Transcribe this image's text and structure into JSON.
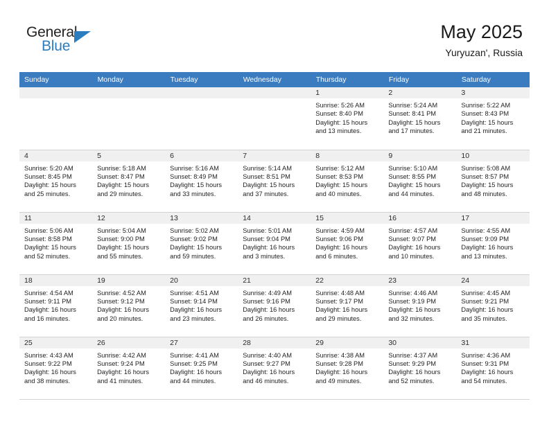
{
  "brand": {
    "name_top": "General",
    "name_bottom": "Blue",
    "accent_color": "#2c7cc0"
  },
  "header": {
    "title": "May 2025",
    "subtitle": "Yuryuzan', Russia",
    "header_bg": "#3b7cc0",
    "daynum_bg": "#f0f0f0"
  },
  "weekdays": [
    "Sunday",
    "Monday",
    "Tuesday",
    "Wednesday",
    "Thursday",
    "Friday",
    "Saturday"
  ],
  "weeks": [
    [
      {
        "day": ""
      },
      {
        "day": ""
      },
      {
        "day": ""
      },
      {
        "day": ""
      },
      {
        "day": "1",
        "sunrise": "Sunrise: 5:26 AM",
        "sunset": "Sunset: 8:40 PM",
        "daylight1": "Daylight: 15 hours",
        "daylight2": "and 13 minutes."
      },
      {
        "day": "2",
        "sunrise": "Sunrise: 5:24 AM",
        "sunset": "Sunset: 8:41 PM",
        "daylight1": "Daylight: 15 hours",
        "daylight2": "and 17 minutes."
      },
      {
        "day": "3",
        "sunrise": "Sunrise: 5:22 AM",
        "sunset": "Sunset: 8:43 PM",
        "daylight1": "Daylight: 15 hours",
        "daylight2": "and 21 minutes."
      }
    ],
    [
      {
        "day": "4",
        "sunrise": "Sunrise: 5:20 AM",
        "sunset": "Sunset: 8:45 PM",
        "daylight1": "Daylight: 15 hours",
        "daylight2": "and 25 minutes."
      },
      {
        "day": "5",
        "sunrise": "Sunrise: 5:18 AM",
        "sunset": "Sunset: 8:47 PM",
        "daylight1": "Daylight: 15 hours",
        "daylight2": "and 29 minutes."
      },
      {
        "day": "6",
        "sunrise": "Sunrise: 5:16 AM",
        "sunset": "Sunset: 8:49 PM",
        "daylight1": "Daylight: 15 hours",
        "daylight2": "and 33 minutes."
      },
      {
        "day": "7",
        "sunrise": "Sunrise: 5:14 AM",
        "sunset": "Sunset: 8:51 PM",
        "daylight1": "Daylight: 15 hours",
        "daylight2": "and 37 minutes."
      },
      {
        "day": "8",
        "sunrise": "Sunrise: 5:12 AM",
        "sunset": "Sunset: 8:53 PM",
        "daylight1": "Daylight: 15 hours",
        "daylight2": "and 40 minutes."
      },
      {
        "day": "9",
        "sunrise": "Sunrise: 5:10 AM",
        "sunset": "Sunset: 8:55 PM",
        "daylight1": "Daylight: 15 hours",
        "daylight2": "and 44 minutes."
      },
      {
        "day": "10",
        "sunrise": "Sunrise: 5:08 AM",
        "sunset": "Sunset: 8:57 PM",
        "daylight1": "Daylight: 15 hours",
        "daylight2": "and 48 minutes."
      }
    ],
    [
      {
        "day": "11",
        "sunrise": "Sunrise: 5:06 AM",
        "sunset": "Sunset: 8:58 PM",
        "daylight1": "Daylight: 15 hours",
        "daylight2": "and 52 minutes."
      },
      {
        "day": "12",
        "sunrise": "Sunrise: 5:04 AM",
        "sunset": "Sunset: 9:00 PM",
        "daylight1": "Daylight: 15 hours",
        "daylight2": "and 55 minutes."
      },
      {
        "day": "13",
        "sunrise": "Sunrise: 5:02 AM",
        "sunset": "Sunset: 9:02 PM",
        "daylight1": "Daylight: 15 hours",
        "daylight2": "and 59 minutes."
      },
      {
        "day": "14",
        "sunrise": "Sunrise: 5:01 AM",
        "sunset": "Sunset: 9:04 PM",
        "daylight1": "Daylight: 16 hours",
        "daylight2": "and 3 minutes."
      },
      {
        "day": "15",
        "sunrise": "Sunrise: 4:59 AM",
        "sunset": "Sunset: 9:06 PM",
        "daylight1": "Daylight: 16 hours",
        "daylight2": "and 6 minutes."
      },
      {
        "day": "16",
        "sunrise": "Sunrise: 4:57 AM",
        "sunset": "Sunset: 9:07 PM",
        "daylight1": "Daylight: 16 hours",
        "daylight2": "and 10 minutes."
      },
      {
        "day": "17",
        "sunrise": "Sunrise: 4:55 AM",
        "sunset": "Sunset: 9:09 PM",
        "daylight1": "Daylight: 16 hours",
        "daylight2": "and 13 minutes."
      }
    ],
    [
      {
        "day": "18",
        "sunrise": "Sunrise: 4:54 AM",
        "sunset": "Sunset: 9:11 PM",
        "daylight1": "Daylight: 16 hours",
        "daylight2": "and 16 minutes."
      },
      {
        "day": "19",
        "sunrise": "Sunrise: 4:52 AM",
        "sunset": "Sunset: 9:12 PM",
        "daylight1": "Daylight: 16 hours",
        "daylight2": "and 20 minutes."
      },
      {
        "day": "20",
        "sunrise": "Sunrise: 4:51 AM",
        "sunset": "Sunset: 9:14 PM",
        "daylight1": "Daylight: 16 hours",
        "daylight2": "and 23 minutes."
      },
      {
        "day": "21",
        "sunrise": "Sunrise: 4:49 AM",
        "sunset": "Sunset: 9:16 PM",
        "daylight1": "Daylight: 16 hours",
        "daylight2": "and 26 minutes."
      },
      {
        "day": "22",
        "sunrise": "Sunrise: 4:48 AM",
        "sunset": "Sunset: 9:17 PM",
        "daylight1": "Daylight: 16 hours",
        "daylight2": "and 29 minutes."
      },
      {
        "day": "23",
        "sunrise": "Sunrise: 4:46 AM",
        "sunset": "Sunset: 9:19 PM",
        "daylight1": "Daylight: 16 hours",
        "daylight2": "and 32 minutes."
      },
      {
        "day": "24",
        "sunrise": "Sunrise: 4:45 AM",
        "sunset": "Sunset: 9:21 PM",
        "daylight1": "Daylight: 16 hours",
        "daylight2": "and 35 minutes."
      }
    ],
    [
      {
        "day": "25",
        "sunrise": "Sunrise: 4:43 AM",
        "sunset": "Sunset: 9:22 PM",
        "daylight1": "Daylight: 16 hours",
        "daylight2": "and 38 minutes."
      },
      {
        "day": "26",
        "sunrise": "Sunrise: 4:42 AM",
        "sunset": "Sunset: 9:24 PM",
        "daylight1": "Daylight: 16 hours",
        "daylight2": "and 41 minutes."
      },
      {
        "day": "27",
        "sunrise": "Sunrise: 4:41 AM",
        "sunset": "Sunset: 9:25 PM",
        "daylight1": "Daylight: 16 hours",
        "daylight2": "and 44 minutes."
      },
      {
        "day": "28",
        "sunrise": "Sunrise: 4:40 AM",
        "sunset": "Sunset: 9:27 PM",
        "daylight1": "Daylight: 16 hours",
        "daylight2": "and 46 minutes."
      },
      {
        "day": "29",
        "sunrise": "Sunrise: 4:38 AM",
        "sunset": "Sunset: 9:28 PM",
        "daylight1": "Daylight: 16 hours",
        "daylight2": "and 49 minutes."
      },
      {
        "day": "30",
        "sunrise": "Sunrise: 4:37 AM",
        "sunset": "Sunset: 9:29 PM",
        "daylight1": "Daylight: 16 hours",
        "daylight2": "and 52 minutes."
      },
      {
        "day": "31",
        "sunrise": "Sunrise: 4:36 AM",
        "sunset": "Sunset: 9:31 PM",
        "daylight1": "Daylight: 16 hours",
        "daylight2": "and 54 minutes."
      }
    ]
  ]
}
